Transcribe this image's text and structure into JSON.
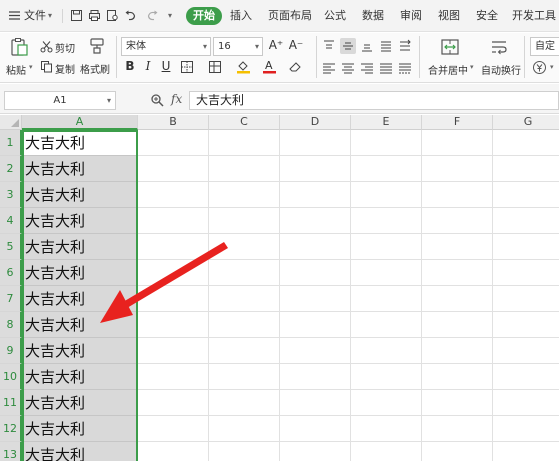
{
  "menubar": {
    "file_label": "文件",
    "tabs": [
      "开始",
      "插入",
      "页面布局",
      "公式",
      "数据",
      "审阅",
      "视图",
      "安全",
      "开发工具"
    ],
    "active_tab": "开始"
  },
  "ribbon": {
    "paste_label": "粘贴",
    "cut_label": "剪切",
    "copy_label": "复制",
    "format_painter_label": "格式刷",
    "font_name": "宋体",
    "font_size": "16",
    "bold_glyph": "B",
    "italic_glyph": "I",
    "underline_glyph": "U",
    "grow_font_glyph": "A⁺",
    "shrink_font_glyph": "A⁻",
    "font_color_glyph": "A",
    "merge_center_label": "合并居中",
    "wrap_text_label": "自动换行",
    "custom_format_label": "自定",
    "colors": {
      "accent": "#3c9d4a",
      "font_color_bar": "#e02020",
      "fill_color_bar": "#f5c000"
    }
  },
  "formula_bar": {
    "name_box": "A1",
    "fx_label": "fx",
    "formula_value": "大吉大利",
    "search_icon": "zoom-icon"
  },
  "sheet": {
    "columns": [
      "A",
      "B",
      "C",
      "D",
      "E",
      "F",
      "G"
    ],
    "rows": [
      "1",
      "2",
      "3",
      "4",
      "5",
      "6",
      "7",
      "8",
      "9",
      "10",
      "11",
      "12",
      "13"
    ],
    "column_a_values": [
      "大吉大利",
      "大吉大利",
      "大吉大利",
      "大吉大利",
      "大吉大利",
      "大吉大利",
      "大吉大利",
      "大吉大利",
      "大吉大利",
      "大吉大利",
      "大吉大利",
      "大吉大利",
      "大吉大利"
    ],
    "selected_column": "A",
    "active_cell": "A1",
    "annotation": {
      "type": "arrow",
      "color": "#e8221f",
      "points_to_row": "8"
    }
  }
}
